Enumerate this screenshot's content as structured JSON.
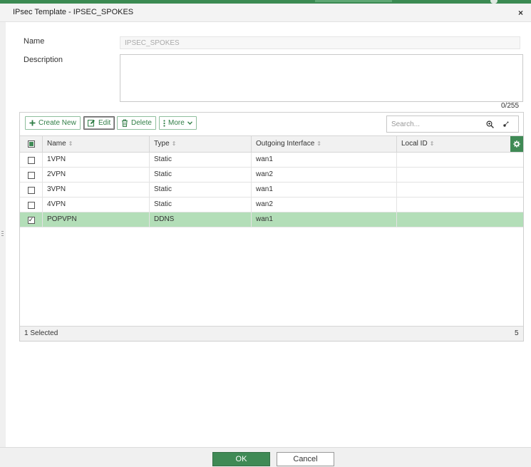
{
  "dialog": {
    "title": "IPsec Template - IPSEC_SPOKES",
    "close_glyph": "×"
  },
  "form": {
    "name_label": "Name",
    "name_value": "IPSEC_SPOKES",
    "description_label": "Description",
    "description_value": "",
    "description_counter": "0/255"
  },
  "toolbar": {
    "create_new_label": "Create New",
    "edit_label": "Edit",
    "delete_label": "Delete",
    "more_label": "More",
    "search_placeholder": "Search..."
  },
  "table": {
    "columns": [
      "Name",
      "Type",
      "Outgoing Interface",
      "Local ID"
    ],
    "rows": [
      {
        "name": "1VPN",
        "type": "Static",
        "interface": "wan1",
        "local_id": "",
        "checked": false
      },
      {
        "name": "2VPN",
        "type": "Static",
        "interface": "wan2",
        "local_id": "",
        "checked": false
      },
      {
        "name": "3VPN",
        "type": "Static",
        "interface": "wan1",
        "local_id": "",
        "checked": false
      },
      {
        "name": "4VPN",
        "type": "Static",
        "interface": "wan2",
        "local_id": "",
        "checked": false
      },
      {
        "name": "POPVPN",
        "type": "DDNS",
        "interface": "wan1",
        "local_id": "",
        "checked": true
      }
    ],
    "footer_selected": "1 Selected",
    "footer_total": "5",
    "check_glyph": "✓",
    "sort_glyph": "⇕"
  },
  "actions": {
    "ok_label": "OK",
    "cancel_label": "Cancel"
  },
  "colors": {
    "accent": "#3f8a55",
    "selected_row": "#b3deb8"
  },
  "icons": [
    "plus-icon",
    "edit-icon",
    "trash-icon",
    "more-vertical-icon",
    "chevron-down-icon",
    "search-zoom-icon",
    "clear-search-icon",
    "gear-icon"
  ]
}
